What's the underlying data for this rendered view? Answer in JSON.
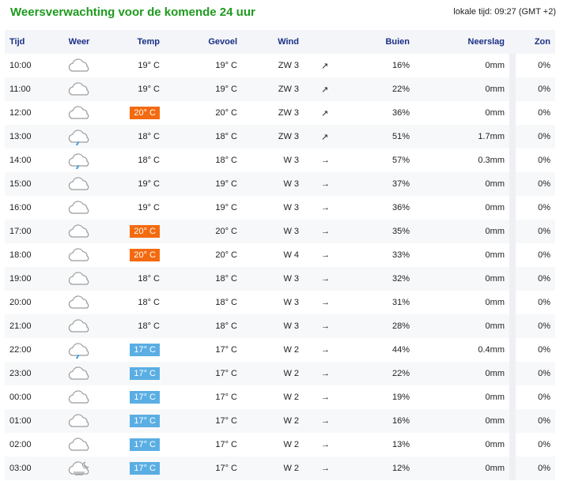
{
  "header": {
    "title": "Weersverwachting voor de komende 24 uur",
    "local_time": "lokale tijd: 09:27 (GMT +2)"
  },
  "columns": {
    "time": "Tijd",
    "weather": "Weer",
    "temp": "Temp",
    "feel": "Gevoel",
    "wind": "Wind",
    "rain": "Buien",
    "precip": "Neerslag",
    "sun": "Zon"
  },
  "colors": {
    "warm_badge": "#f36a10",
    "cool_badge": "#5aaee3",
    "title": "#1e9a1e",
    "header_text": "#1a2f86"
  },
  "rows": [
    {
      "time": "10:00",
      "icon": "cloud-icon",
      "temp": "19° C",
      "temp_badge": "none",
      "feel": "19° C",
      "wind": "ZW 3",
      "wind_dir": "southwest",
      "rain": "16%",
      "precip": "0mm",
      "sun": "0%"
    },
    {
      "time": "11:00",
      "icon": "cloud-icon",
      "temp": "19° C",
      "temp_badge": "none",
      "feel": "19° C",
      "wind": "ZW 3",
      "wind_dir": "southwest",
      "rain": "22%",
      "precip": "0mm",
      "sun": "0%"
    },
    {
      "time": "12:00",
      "icon": "cloud-icon",
      "temp": "20° C",
      "temp_badge": "warm",
      "feel": "20° C",
      "wind": "ZW 3",
      "wind_dir": "southwest",
      "rain": "36%",
      "precip": "0mm",
      "sun": "0%"
    },
    {
      "time": "13:00",
      "icon": "cloud-rain-icon",
      "temp": "18° C",
      "temp_badge": "none",
      "feel": "18° C",
      "wind": "ZW 3",
      "wind_dir": "southwest",
      "rain": "51%",
      "precip": "1.7mm",
      "sun": "0%"
    },
    {
      "time": "14:00",
      "icon": "cloud-rain-icon",
      "temp": "18° C",
      "temp_badge": "none",
      "feel": "18° C",
      "wind": "W 3",
      "wind_dir": "west",
      "rain": "57%",
      "precip": "0.3mm",
      "sun": "0%"
    },
    {
      "time": "15:00",
      "icon": "cloud-icon",
      "temp": "19° C",
      "temp_badge": "none",
      "feel": "19° C",
      "wind": "W 3",
      "wind_dir": "west",
      "rain": "37%",
      "precip": "0mm",
      "sun": "0%"
    },
    {
      "time": "16:00",
      "icon": "cloud-icon",
      "temp": "19° C",
      "temp_badge": "none",
      "feel": "19° C",
      "wind": "W 3",
      "wind_dir": "west",
      "rain": "36%",
      "precip": "0mm",
      "sun": "0%"
    },
    {
      "time": "17:00",
      "icon": "cloud-icon",
      "temp": "20° C",
      "temp_badge": "warm",
      "feel": "20° C",
      "wind": "W 3",
      "wind_dir": "west",
      "rain": "35%",
      "precip": "0mm",
      "sun": "0%"
    },
    {
      "time": "18:00",
      "icon": "cloud-icon",
      "temp": "20° C",
      "temp_badge": "warm",
      "feel": "20° C",
      "wind": "W 4",
      "wind_dir": "west",
      "rain": "33%",
      "precip": "0mm",
      "sun": "0%"
    },
    {
      "time": "19:00",
      "icon": "cloud-icon",
      "temp": "18° C",
      "temp_badge": "none",
      "feel": "18° C",
      "wind": "W 3",
      "wind_dir": "west",
      "rain": "32%",
      "precip": "0mm",
      "sun": "0%"
    },
    {
      "time": "20:00",
      "icon": "cloud-icon",
      "temp": "18° C",
      "temp_badge": "none",
      "feel": "18° C",
      "wind": "W 3",
      "wind_dir": "west",
      "rain": "31%",
      "precip": "0mm",
      "sun": "0%"
    },
    {
      "time": "21:00",
      "icon": "cloud-icon",
      "temp": "18° C",
      "temp_badge": "none",
      "feel": "18° C",
      "wind": "W 3",
      "wind_dir": "west",
      "rain": "28%",
      "precip": "0mm",
      "sun": "0%"
    },
    {
      "time": "22:00",
      "icon": "cloud-rain-icon",
      "temp": "17° C",
      "temp_badge": "cool",
      "feel": "17° C",
      "wind": "W 2",
      "wind_dir": "west",
      "rain": "44%",
      "precip": "0.4mm",
      "sun": "0%"
    },
    {
      "time": "23:00",
      "icon": "cloud-icon",
      "temp": "17° C",
      "temp_badge": "cool",
      "feel": "17° C",
      "wind": "W 2",
      "wind_dir": "west",
      "rain": "22%",
      "precip": "0mm",
      "sun": "0%"
    },
    {
      "time": "00:00",
      "icon": "cloud-icon",
      "temp": "17° C",
      "temp_badge": "cool",
      "feel": "17° C",
      "wind": "W 2",
      "wind_dir": "west",
      "rain": "19%",
      "precip": "0mm",
      "sun": "0%"
    },
    {
      "time": "01:00",
      "icon": "cloud-icon",
      "temp": "17° C",
      "temp_badge": "cool",
      "feel": "17° C",
      "wind": "W 2",
      "wind_dir": "west",
      "rain": "16%",
      "precip": "0mm",
      "sun": "0%"
    },
    {
      "time": "02:00",
      "icon": "cloud-icon",
      "temp": "17° C",
      "temp_badge": "cool",
      "feel": "17° C",
      "wind": "W 2",
      "wind_dir": "west",
      "rain": "13%",
      "precip": "0mm",
      "sun": "0%"
    },
    {
      "time": "03:00",
      "icon": "cloud-fog-moon-icon",
      "temp": "17° C",
      "temp_badge": "cool",
      "feel": "17° C",
      "wind": "W 2",
      "wind_dir": "west",
      "rain": "12%",
      "precip": "0mm",
      "sun": "0%"
    }
  ]
}
